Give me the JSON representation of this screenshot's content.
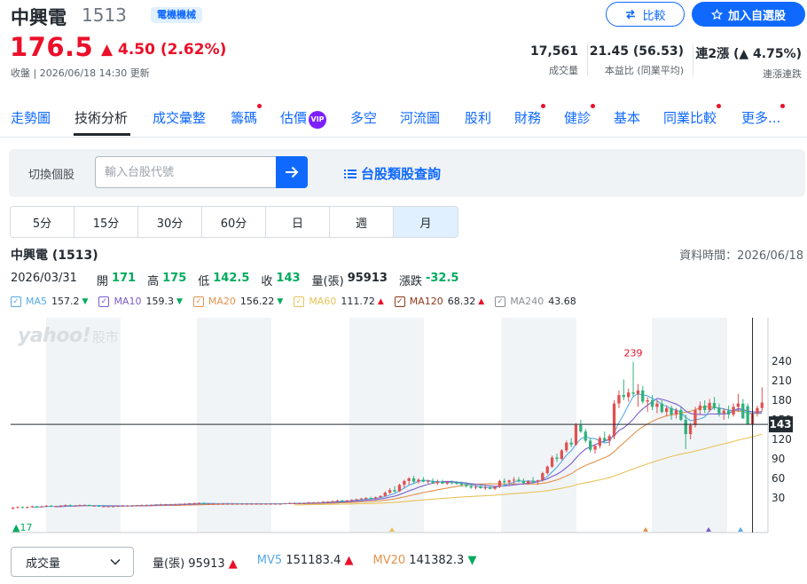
{
  "header": {
    "name": "中興電",
    "code": "1513",
    "industry": "電機機械",
    "compare_label": "比較",
    "watchlist_label": "加入自選股",
    "price": "176.5",
    "change": "▲ 4.50 (2.62%)",
    "close_info": "收盤 | 2026/06/18 14:30 更新"
  },
  "stats": {
    "volume_value": "17,561",
    "volume_label": "成交量",
    "pe_value": "21.45 (56.53)",
    "pe_label": "本益比 (同業平均)",
    "streak_value_prefix": "連2漲",
    "streak_value_suffix": "(▲ 4.75%)",
    "streak_label": "連漲連跌"
  },
  "tabs": [
    {
      "label": "走勢圖",
      "dot": false
    },
    {
      "label": "技術分析",
      "dot": false,
      "active": true
    },
    {
      "label": "成交彙整",
      "dot": false
    },
    {
      "label": "籌碼",
      "dot": true
    },
    {
      "label": "估價",
      "dot": false,
      "vip": "VIP"
    },
    {
      "label": "多空",
      "dot": false
    },
    {
      "label": "河流圖",
      "dot": false
    },
    {
      "label": "股利",
      "dot": false
    },
    {
      "label": "財務",
      "dot": true
    },
    {
      "label": "健診",
      "dot": true
    },
    {
      "label": "基本",
      "dot": false
    },
    {
      "label": "同業比較",
      "dot": true
    },
    {
      "label": "更多...",
      "dot": true
    }
  ],
  "switcher": {
    "label": "切換個股",
    "placeholder": "輸入台股代號",
    "category_link": "台股類股查詢"
  },
  "periods": [
    {
      "label": "5分"
    },
    {
      "label": "15分"
    },
    {
      "label": "30分"
    },
    {
      "label": "60分"
    },
    {
      "label": "日"
    },
    {
      "label": "週"
    },
    {
      "label": "月",
      "active": true
    }
  ],
  "chart_header": {
    "title": "中興電 (1513)",
    "data_time": "資料時間：2026/06/18"
  },
  "ohlc": {
    "date": "2026/03/31",
    "open_label": "開",
    "open": "171",
    "high_label": "高",
    "high": "175",
    "low_label": "低",
    "low": "142.5",
    "close_label": "收",
    "close": "143",
    "volume_label": "量(張)",
    "volume": "95913",
    "change_label": "漲跌",
    "change": "-32.5"
  },
  "ma_legend": [
    {
      "name": "MA5",
      "value": "157.2",
      "dir": "down",
      "color": "#56a9e6"
    },
    {
      "name": "MA10",
      "value": "159.3",
      "dir": "down",
      "color": "#7a5cc8"
    },
    {
      "name": "MA20",
      "value": "156.22",
      "dir": "down",
      "color": "#e2924d"
    },
    {
      "name": "MA60",
      "value": "111.72",
      "dir": "up",
      "color": "#e8c25a"
    },
    {
      "name": "MA120",
      "value": "68.32",
      "dir": "up",
      "color": "#8b3a1a"
    },
    {
      "name": "MA240",
      "value": "43.68",
      "dir": "none",
      "color": "#8a8f94"
    }
  ],
  "watermark": {
    "brand": "yahoo!",
    "suffix": "股市"
  },
  "chart_data": {
    "type": "candlestick",
    "y_ticks": [
      240,
      210,
      180,
      150,
      120,
      90,
      60,
      30
    ],
    "ylim": [
      0,
      255
    ],
    "crosshair_value": "143",
    "high_label": "239",
    "low_label": "17",
    "candles": [
      {
        "o": 14,
        "h": 16,
        "l": 12,
        "c": 15
      },
      {
        "o": 15,
        "h": 17,
        "l": 14,
        "c": 16
      },
      {
        "o": 16,
        "h": 17,
        "l": 14,
        "c": 15
      },
      {
        "o": 15,
        "h": 17,
        "l": 14,
        "c": 16
      },
      {
        "o": 16,
        "h": 18,
        "l": 15,
        "c": 17
      },
      {
        "o": 17,
        "h": 18,
        "l": 15,
        "c": 16
      },
      {
        "o": 16,
        "h": 18,
        "l": 15,
        "c": 17
      },
      {
        "o": 17,
        "h": 19,
        "l": 16,
        "c": 18
      },
      {
        "o": 18,
        "h": 19,
        "l": 16,
        "c": 17
      },
      {
        "o": 17,
        "h": 18,
        "l": 16,
        "c": 17
      },
      {
        "o": 17,
        "h": 19,
        "l": 16,
        "c": 18
      },
      {
        "o": 18,
        "h": 20,
        "l": 17,
        "c": 19
      },
      {
        "o": 19,
        "h": 20,
        "l": 17,
        "c": 18
      },
      {
        "o": 18,
        "h": 19,
        "l": 17,
        "c": 18
      },
      {
        "o": 18,
        "h": 20,
        "l": 17,
        "c": 19
      },
      {
        "o": 19,
        "h": 20,
        "l": 18,
        "c": 19
      },
      {
        "o": 19,
        "h": 20,
        "l": 17,
        "c": 18
      },
      {
        "o": 18,
        "h": 19,
        "l": 17,
        "c": 18
      },
      {
        "o": 18,
        "h": 19,
        "l": 16,
        "c": 17
      },
      {
        "o": 17,
        "h": 18,
        "l": 16,
        "c": 17
      },
      {
        "o": 17,
        "h": 18,
        "l": 16,
        "c": 17
      },
      {
        "o": 17,
        "h": 18,
        "l": 16,
        "c": 17
      },
      {
        "o": 17,
        "h": 18,
        "l": 16,
        "c": 18
      },
      {
        "o": 18,
        "h": 19,
        "l": 17,
        "c": 18
      },
      {
        "o": 18,
        "h": 19,
        "l": 17,
        "c": 18
      },
      {
        "o": 18,
        "h": 19,
        "l": 17,
        "c": 18
      },
      {
        "o": 18,
        "h": 19,
        "l": 17,
        "c": 19
      },
      {
        "o": 19,
        "h": 20,
        "l": 18,
        "c": 19
      },
      {
        "o": 19,
        "h": 20,
        "l": 18,
        "c": 19
      },
      {
        "o": 19,
        "h": 20,
        "l": 18,
        "c": 19
      },
      {
        "o": 19,
        "h": 20,
        "l": 18,
        "c": 20
      },
      {
        "o": 20,
        "h": 21,
        "l": 19,
        "c": 20
      },
      {
        "o": 20,
        "h": 21,
        "l": 19,
        "c": 20
      },
      {
        "o": 20,
        "h": 21,
        "l": 19,
        "c": 20
      },
      {
        "o": 20,
        "h": 21,
        "l": 19,
        "c": 20
      },
      {
        "o": 20,
        "h": 21,
        "l": 19,
        "c": 21
      },
      {
        "o": 21,
        "h": 22,
        "l": 20,
        "c": 21
      },
      {
        "o": 21,
        "h": 22,
        "l": 20,
        "c": 22
      },
      {
        "o": 22,
        "h": 23,
        "l": 21,
        "c": 22
      },
      {
        "o": 22,
        "h": 23,
        "l": 21,
        "c": 22
      },
      {
        "o": 22,
        "h": 23,
        "l": 20,
        "c": 21
      },
      {
        "o": 21,
        "h": 22,
        "l": 20,
        "c": 21
      },
      {
        "o": 21,
        "h": 22,
        "l": 20,
        "c": 21
      },
      {
        "o": 21,
        "h": 22,
        "l": 20,
        "c": 21
      },
      {
        "o": 21,
        "h": 22,
        "l": 20,
        "c": 21
      },
      {
        "o": 21,
        "h": 22,
        "l": 20,
        "c": 21
      },
      {
        "o": 21,
        "h": 22,
        "l": 20,
        "c": 21
      },
      {
        "o": 21,
        "h": 22,
        "l": 20,
        "c": 21
      },
      {
        "o": 21,
        "h": 22,
        "l": 20,
        "c": 21
      },
      {
        "o": 21,
        "h": 22,
        "l": 20,
        "c": 21
      },
      {
        "o": 21,
        "h": 22,
        "l": 20,
        "c": 21
      },
      {
        "o": 21,
        "h": 22,
        "l": 20,
        "c": 21
      },
      {
        "o": 21,
        "h": 22,
        "l": 20,
        "c": 21
      },
      {
        "o": 21,
        "h": 22,
        "l": 20,
        "c": 21
      },
      {
        "o": 21,
        "h": 22,
        "l": 20,
        "c": 21
      },
      {
        "o": 21,
        "h": 22,
        "l": 20,
        "c": 21
      },
      {
        "o": 21,
        "h": 22,
        "l": 20,
        "c": 21
      },
      {
        "o": 21,
        "h": 22,
        "l": 20,
        "c": 22
      },
      {
        "o": 22,
        "h": 23,
        "l": 21,
        "c": 22
      },
      {
        "o": 22,
        "h": 23,
        "l": 21,
        "c": 22
      },
      {
        "o": 22,
        "h": 23,
        "l": 21,
        "c": 22
      },
      {
        "o": 22,
        "h": 23,
        "l": 21,
        "c": 22
      },
      {
        "o": 22,
        "h": 24,
        "l": 21,
        "c": 23
      },
      {
        "o": 23,
        "h": 24,
        "l": 22,
        "c": 23
      },
      {
        "o": 23,
        "h": 24,
        "l": 22,
        "c": 23
      },
      {
        "o": 23,
        "h": 25,
        "l": 22,
        "c": 24
      },
      {
        "o": 24,
        "h": 25,
        "l": 23,
        "c": 24
      },
      {
        "o": 24,
        "h": 26,
        "l": 23,
        "c": 25
      },
      {
        "o": 25,
        "h": 27,
        "l": 24,
        "c": 26
      },
      {
        "o": 26,
        "h": 27,
        "l": 24,
        "c": 25
      },
      {
        "o": 25,
        "h": 27,
        "l": 24,
        "c": 26
      },
      {
        "o": 26,
        "h": 28,
        "l": 25,
        "c": 27
      },
      {
        "o": 27,
        "h": 29,
        "l": 26,
        "c": 28
      },
      {
        "o": 28,
        "h": 30,
        "l": 27,
        "c": 29
      },
      {
        "o": 29,
        "h": 31,
        "l": 27,
        "c": 30
      },
      {
        "o": 30,
        "h": 32,
        "l": 28,
        "c": 29
      },
      {
        "o": 29,
        "h": 32,
        "l": 28,
        "c": 31
      },
      {
        "o": 31,
        "h": 34,
        "l": 30,
        "c": 33
      },
      {
        "o": 33,
        "h": 40,
        "l": 32,
        "c": 38
      },
      {
        "o": 38,
        "h": 45,
        "l": 36,
        "c": 42
      },
      {
        "o": 42,
        "h": 48,
        "l": 38,
        "c": 40
      },
      {
        "o": 40,
        "h": 52,
        "l": 39,
        "c": 50
      },
      {
        "o": 50,
        "h": 58,
        "l": 45,
        "c": 56
      },
      {
        "o": 56,
        "h": 62,
        "l": 50,
        "c": 60
      },
      {
        "o": 60,
        "h": 64,
        "l": 52,
        "c": 55
      },
      {
        "o": 55,
        "h": 60,
        "l": 52,
        "c": 58
      },
      {
        "o": 58,
        "h": 62,
        "l": 54,
        "c": 55
      },
      {
        "o": 55,
        "h": 58,
        "l": 52,
        "c": 56
      },
      {
        "o": 56,
        "h": 60,
        "l": 52,
        "c": 53
      },
      {
        "o": 53,
        "h": 58,
        "l": 50,
        "c": 55
      },
      {
        "o": 55,
        "h": 58,
        "l": 51,
        "c": 52
      },
      {
        "o": 52,
        "h": 56,
        "l": 50,
        "c": 54
      },
      {
        "o": 54,
        "h": 57,
        "l": 51,
        "c": 53
      },
      {
        "o": 53,
        "h": 56,
        "l": 50,
        "c": 52
      },
      {
        "o": 52,
        "h": 55,
        "l": 48,
        "c": 50
      },
      {
        "o": 50,
        "h": 54,
        "l": 46,
        "c": 48
      },
      {
        "o": 48,
        "h": 52,
        "l": 44,
        "c": 46
      },
      {
        "o": 46,
        "h": 50,
        "l": 43,
        "c": 47
      },
      {
        "o": 47,
        "h": 51,
        "l": 44,
        "c": 45
      },
      {
        "o": 45,
        "h": 49,
        "l": 42,
        "c": 46
      },
      {
        "o": 46,
        "h": 49,
        "l": 43,
        "c": 44
      },
      {
        "o": 44,
        "h": 48,
        "l": 42,
        "c": 47
      },
      {
        "o": 47,
        "h": 58,
        "l": 45,
        "c": 56
      },
      {
        "o": 56,
        "h": 60,
        "l": 50,
        "c": 54
      },
      {
        "o": 54,
        "h": 58,
        "l": 50,
        "c": 57
      },
      {
        "o": 57,
        "h": 62,
        "l": 52,
        "c": 58
      },
      {
        "o": 58,
        "h": 62,
        "l": 54,
        "c": 56
      },
      {
        "o": 56,
        "h": 60,
        "l": 52,
        "c": 53
      },
      {
        "o": 53,
        "h": 57,
        "l": 50,
        "c": 56
      },
      {
        "o": 56,
        "h": 62,
        "l": 52,
        "c": 55
      },
      {
        "o": 55,
        "h": 58,
        "l": 50,
        "c": 57
      },
      {
        "o": 57,
        "h": 70,
        "l": 55,
        "c": 68
      },
      {
        "o": 68,
        "h": 80,
        "l": 66,
        "c": 78
      },
      {
        "o": 78,
        "h": 95,
        "l": 76,
        "c": 92
      },
      {
        "o": 92,
        "h": 98,
        "l": 85,
        "c": 90
      },
      {
        "o": 90,
        "h": 105,
        "l": 88,
        "c": 103
      },
      {
        "o": 103,
        "h": 118,
        "l": 100,
        "c": 115
      },
      {
        "o": 115,
        "h": 122,
        "l": 108,
        "c": 112
      },
      {
        "o": 112,
        "h": 145,
        "l": 110,
        "c": 142
      },
      {
        "o": 142,
        "h": 150,
        "l": 130,
        "c": 132
      },
      {
        "o": 132,
        "h": 136,
        "l": 115,
        "c": 118
      },
      {
        "o": 118,
        "h": 122,
        "l": 100,
        "c": 104
      },
      {
        "o": 104,
        "h": 112,
        "l": 98,
        "c": 110
      },
      {
        "o": 110,
        "h": 125,
        "l": 106,
        "c": 122
      },
      {
        "o": 122,
        "h": 132,
        "l": 115,
        "c": 118
      },
      {
        "o": 118,
        "h": 128,
        "l": 110,
        "c": 125
      },
      {
        "o": 125,
        "h": 180,
        "l": 120,
        "c": 175
      },
      {
        "o": 175,
        "h": 195,
        "l": 168,
        "c": 188
      },
      {
        "o": 188,
        "h": 212,
        "l": 180,
        "c": 185
      },
      {
        "o": 185,
        "h": 198,
        "l": 178,
        "c": 192
      },
      {
        "o": 192,
        "h": 239,
        "l": 185,
        "c": 190
      },
      {
        "o": 190,
        "h": 205,
        "l": 170,
        "c": 195
      },
      {
        "o": 195,
        "h": 202,
        "l": 175,
        "c": 178
      },
      {
        "o": 178,
        "h": 185,
        "l": 162,
        "c": 180
      },
      {
        "o": 180,
        "h": 188,
        "l": 165,
        "c": 170
      },
      {
        "o": 170,
        "h": 180,
        "l": 160,
        "c": 175
      },
      {
        "o": 175,
        "h": 180,
        "l": 160,
        "c": 162
      },
      {
        "o": 162,
        "h": 172,
        "l": 155,
        "c": 168
      },
      {
        "o": 168,
        "h": 172,
        "l": 150,
        "c": 158
      },
      {
        "o": 158,
        "h": 168,
        "l": 152,
        "c": 165
      },
      {
        "o": 165,
        "h": 170,
        "l": 148,
        "c": 150
      },
      {
        "o": 150,
        "h": 158,
        "l": 105,
        "c": 128
      },
      {
        "o": 128,
        "h": 145,
        "l": 120,
        "c": 142
      },
      {
        "o": 142,
        "h": 170,
        "l": 138,
        "c": 165
      },
      {
        "o": 165,
        "h": 178,
        "l": 158,
        "c": 172
      },
      {
        "o": 172,
        "h": 180,
        "l": 160,
        "c": 165
      },
      {
        "o": 165,
        "h": 182,
        "l": 162,
        "c": 176
      },
      {
        "o": 176,
        "h": 185,
        "l": 165,
        "c": 168
      },
      {
        "o": 168,
        "h": 175,
        "l": 155,
        "c": 160
      },
      {
        "o": 160,
        "h": 168,
        "l": 150,
        "c": 164
      },
      {
        "o": 164,
        "h": 172,
        "l": 152,
        "c": 158
      },
      {
        "o": 158,
        "h": 175,
        "l": 155,
        "c": 170
      },
      {
        "o": 170,
        "h": 190,
        "l": 162,
        "c": 175
      },
      {
        "o": 175,
        "h": 182,
        "l": 160,
        "c": 152
      },
      {
        "o": 171,
        "h": 175,
        "l": 142.5,
        "c": 143
      },
      {
        "o": 143,
        "h": 165,
        "l": 140,
        "c": 160
      },
      {
        "o": 160,
        "h": 172,
        "l": 155,
        "c": 168
      },
      {
        "o": 168,
        "h": 200,
        "l": 163,
        "c": 176.5
      }
    ]
  },
  "bottom": {
    "indicator_label": "成交量",
    "vol_label": "量(張)",
    "vol_value": "95913",
    "mv5_label": "MV5",
    "mv5_value": "151183.4",
    "mv20_label": "MV20",
    "mv20_value": "141382.3"
  }
}
